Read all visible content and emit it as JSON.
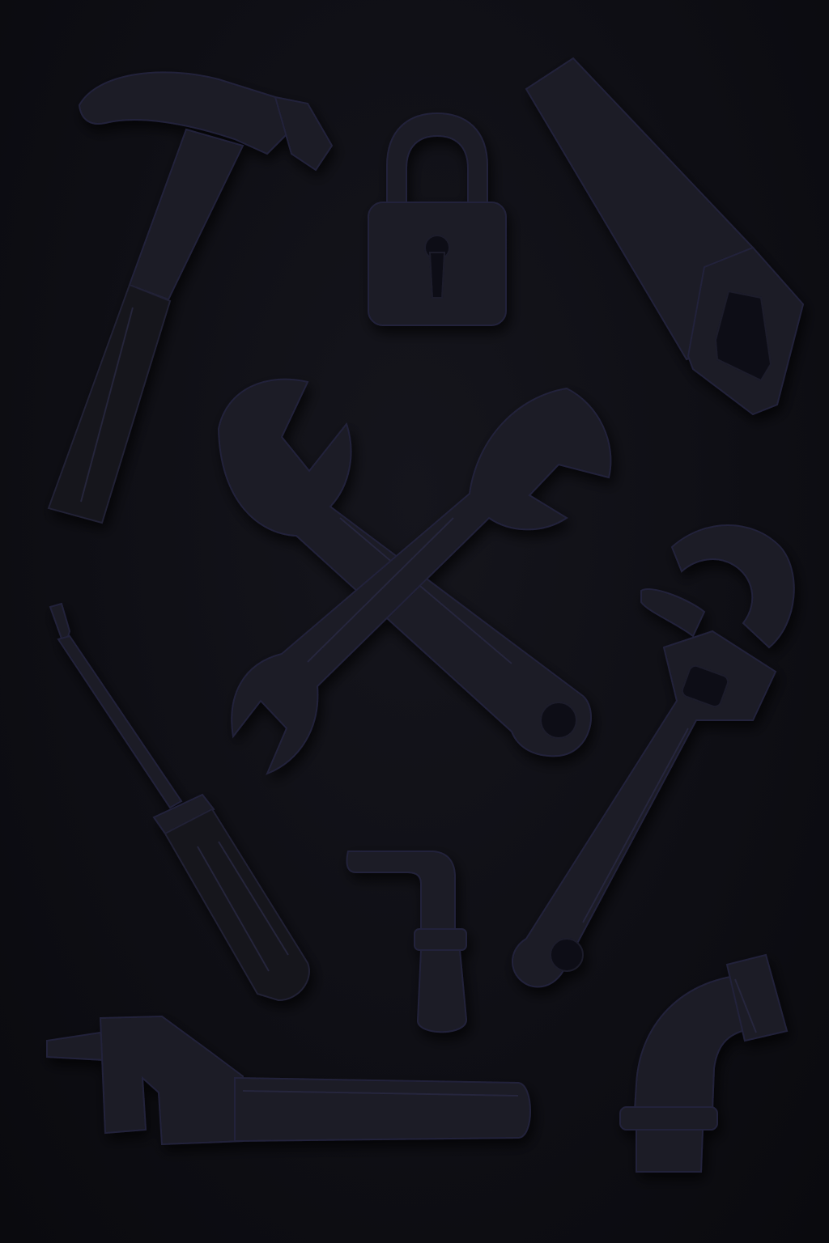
{
  "scene": {
    "background_color": "#0d0d12",
    "tool_color": "#1a1a26",
    "edge_color": "#24243a",
    "icons": [
      "hammer-icon",
      "padlock-icon",
      "hand-saw-icon",
      "crossed-wrenches-icon",
      "screwdriver-icon",
      "adjustable-wrench-icon",
      "hook-tool-icon",
      "plug-wrench-icon",
      "pipe-elbow-icon"
    ]
  }
}
